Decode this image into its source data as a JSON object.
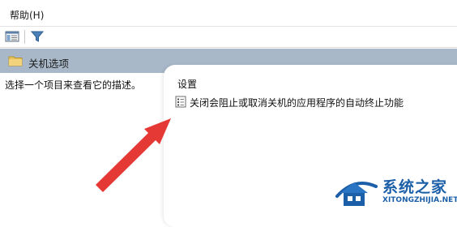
{
  "menubar": {
    "help_label": "帮助(H)"
  },
  "toolbar": {
    "buttons": [
      "show-hide-console-tree-icon",
      "filter-icon"
    ]
  },
  "header": {
    "title": "关机选项",
    "icon": "folder-icon"
  },
  "description_pane": {
    "text": "选择一个项目来查看它的描述。"
  },
  "list": {
    "column_header": "设置",
    "items": [
      {
        "label": "关闭会阻止或取消关机的应用程序的自动终止功能",
        "icon": "policy-setting-icon"
      }
    ]
  },
  "annotation": {
    "icon": "red-arrow-icon",
    "color": "#e53935"
  },
  "watermark": {
    "name": "系统之家",
    "url": "XITONGZHIJIA.NET",
    "color": "#1b5fa8"
  },
  "colors": {
    "header_bg": "#a9b8c9"
  }
}
